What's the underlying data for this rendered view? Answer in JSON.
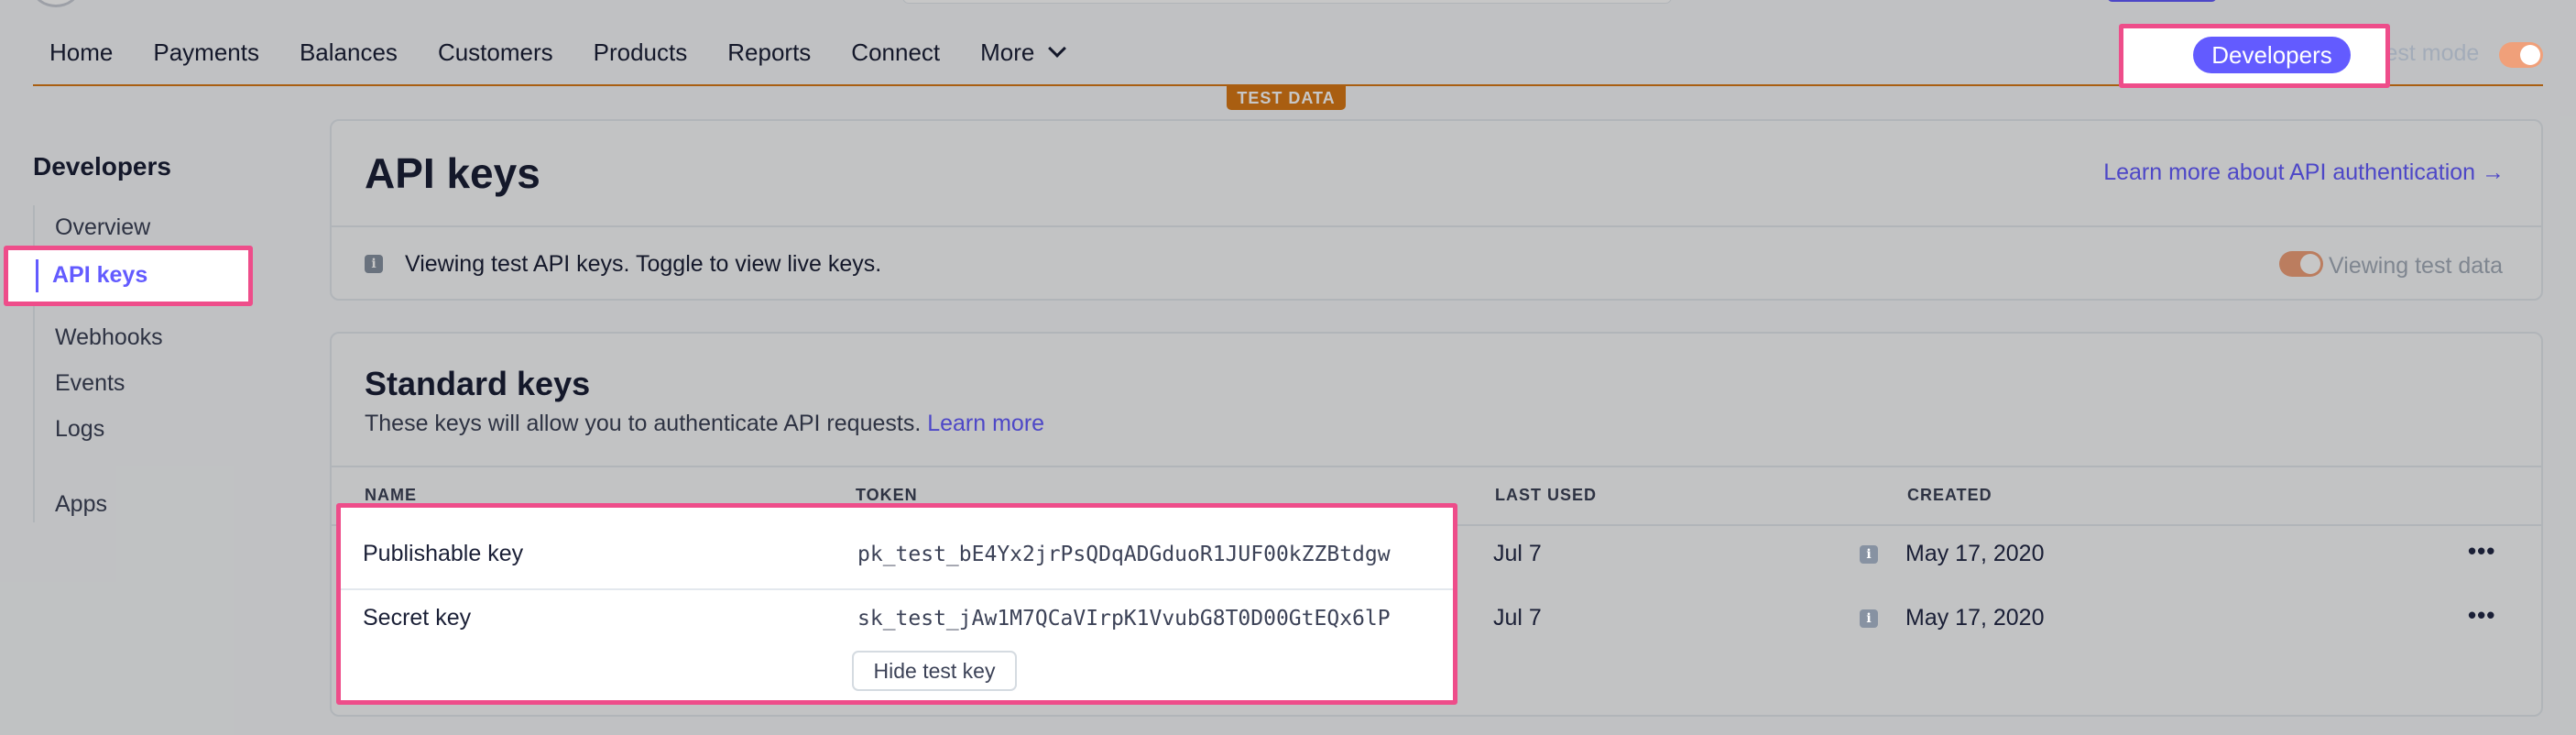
{
  "nav": {
    "items": [
      "Home",
      "Payments",
      "Balances",
      "Customers",
      "Products",
      "Reports",
      "Connect",
      "More"
    ],
    "developers_label": "Developers",
    "test_mode_label": "Test mode",
    "test_data_badge": "TEST DATA"
  },
  "sidebar": {
    "title": "Developers",
    "items": [
      {
        "label": "Overview"
      },
      {
        "label": "API keys",
        "active": true
      },
      {
        "label": "Webhooks"
      },
      {
        "label": "Events"
      },
      {
        "label": "Logs"
      },
      {
        "label": "Apps"
      }
    ]
  },
  "api_card": {
    "title": "API keys",
    "learn_link": "Learn more about API authentication →",
    "notice": "Viewing test API keys. Toggle to view live keys.",
    "toggle_label": "Viewing test data"
  },
  "keys_card": {
    "title": "Standard keys",
    "subtitle": "These keys will allow you to authenticate API requests.",
    "subtitle_link": "Learn more",
    "columns": [
      "NAME",
      "TOKEN",
      "LAST USED",
      "CREATED"
    ],
    "rows": [
      {
        "name": "Publishable key",
        "token": "pk_test_bE4Yx2jrPsQDqADGduoR1JUF00kZZBtdgw",
        "last_used": "Jul 7",
        "created": "May 17, 2020"
      },
      {
        "name": "Secret key",
        "token": "sk_test_jAw1M7QCaVIrpK1VvubG8T0D00GtEQx6lP",
        "last_used": "Jul 7",
        "created": "May 17, 2020"
      }
    ],
    "hide_button": "Hide test key",
    "more_glyph": "•••"
  },
  "icons": {
    "info": "info-icon",
    "chevron": "chevron-down-icon",
    "more": "more-horizontal-icon"
  },
  "colors": {
    "accent": "#635bff",
    "highlight": "#ee4d8a",
    "test_orange": "#d97917"
  }
}
